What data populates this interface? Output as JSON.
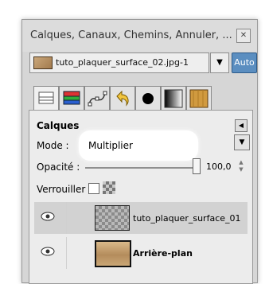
{
  "window": {
    "title": "Calques, Canaux, Chemins, Annuler, ...",
    "close_icon": "close-icon"
  },
  "image_selector": {
    "value": "tuto_plaquer_surface_02.jpg-1",
    "auto_label": "Auto"
  },
  "tabs": [
    {
      "icon": "layers-icon",
      "active": true
    },
    {
      "icon": "channels-icon",
      "active": false
    },
    {
      "icon": "paths-icon",
      "active": false
    },
    {
      "icon": "undo-icon",
      "active": false
    },
    {
      "icon": "brush-icon",
      "active": false
    },
    {
      "icon": "gradient-icon",
      "active": false
    },
    {
      "icon": "pattern-icon",
      "active": false
    }
  ],
  "layers_panel": {
    "title": "Calques",
    "mode_label": "Mode :",
    "mode_value": "Multiplier",
    "opacity_label": "Opacité :",
    "opacity_value": "100,0",
    "lock_label": "Verrouiller :",
    "layers": [
      {
        "name": "tuto_plaquer_surface_01",
        "visible": true,
        "selected": true
      },
      {
        "name": "Arrière-plan",
        "visible": true,
        "selected": false
      }
    ]
  },
  "colors": {
    "auto_button": "#5b8ec0",
    "panel_bg": "#d6d6d6"
  }
}
